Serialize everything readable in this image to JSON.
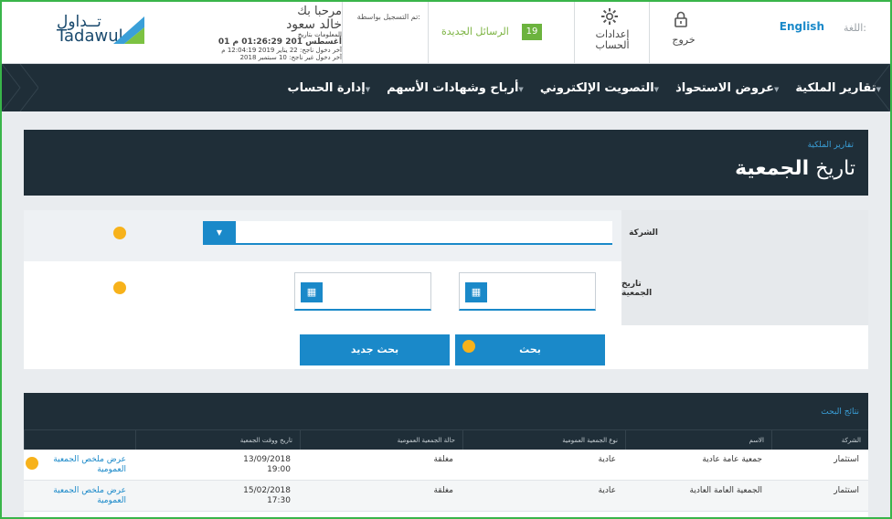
{
  "header": {
    "language_label": "اللغة:",
    "english_link": "English",
    "logout_label": "خروج",
    "settings_label_line1": "إعدادات",
    "settings_label_line2": "الحساب",
    "messages_count": "19",
    "messages_label": "الرسائل الجديدة",
    "login_via_label": "تم التسجيل بواسطة:",
    "welcome_label": "مرحبا بك",
    "user_name": "خالد سعود",
    "info_line1": "المعلومات بتاريخ",
    "info_date": "01 أغسطس 201 01:26:29 م",
    "last_login": "آخر دخول ناجح: 22 يناير 2019 12:04:19 م",
    "last_failed_login": "آخر دخول غير ناجح: 10 سبتمبر 2018",
    "logo_arabic": "تــداول",
    "logo_english": "Tadawul"
  },
  "nav": {
    "items": [
      {
        "label": "تقارير الملكية"
      },
      {
        "label": "عروض الاستحواذ"
      },
      {
        "label": "التصويت الإلكتروني"
      },
      {
        "label": "أرباح وشهادات الأسهم"
      },
      {
        "label": "إدارة الحساب"
      }
    ]
  },
  "page": {
    "breadcrumb": "تقارير الملكية",
    "title_light": "تاريخ",
    "title_bold": "الجمعية"
  },
  "form": {
    "company_label": "الشركة",
    "assembly_date_label": "تاريخ الجمعية",
    "search_button": "بحث",
    "new_search_button": "بحث جديد"
  },
  "results": {
    "title": "نتائج البحث",
    "columns": [
      "الشركة",
      "الاسم",
      "نوع الجمعية العمومية",
      "حالة الجمعية العمومية",
      "تاريخ ووقت الجمعية",
      ""
    ],
    "rows": [
      {
        "company": "استثمار",
        "name": "جمعية عامة عادية",
        "type": "عادية",
        "status": "مغلقة",
        "date": "13/09/2018",
        "time": "19:00",
        "action": "عرض ملخص الجمعية العمومية"
      },
      {
        "company": "استثمار",
        "name": "الجمعية العامة العادية",
        "type": "عادية",
        "status": "مغلقة",
        "date": "15/02/2018",
        "time": "17:30",
        "action": "عرض ملخص الجمعية العمومية"
      }
    ]
  },
  "colors": {
    "dark": "#1f2e38",
    "accent": "#1a89c9",
    "green": "#6cb33e",
    "marker": "#f7b21b"
  }
}
